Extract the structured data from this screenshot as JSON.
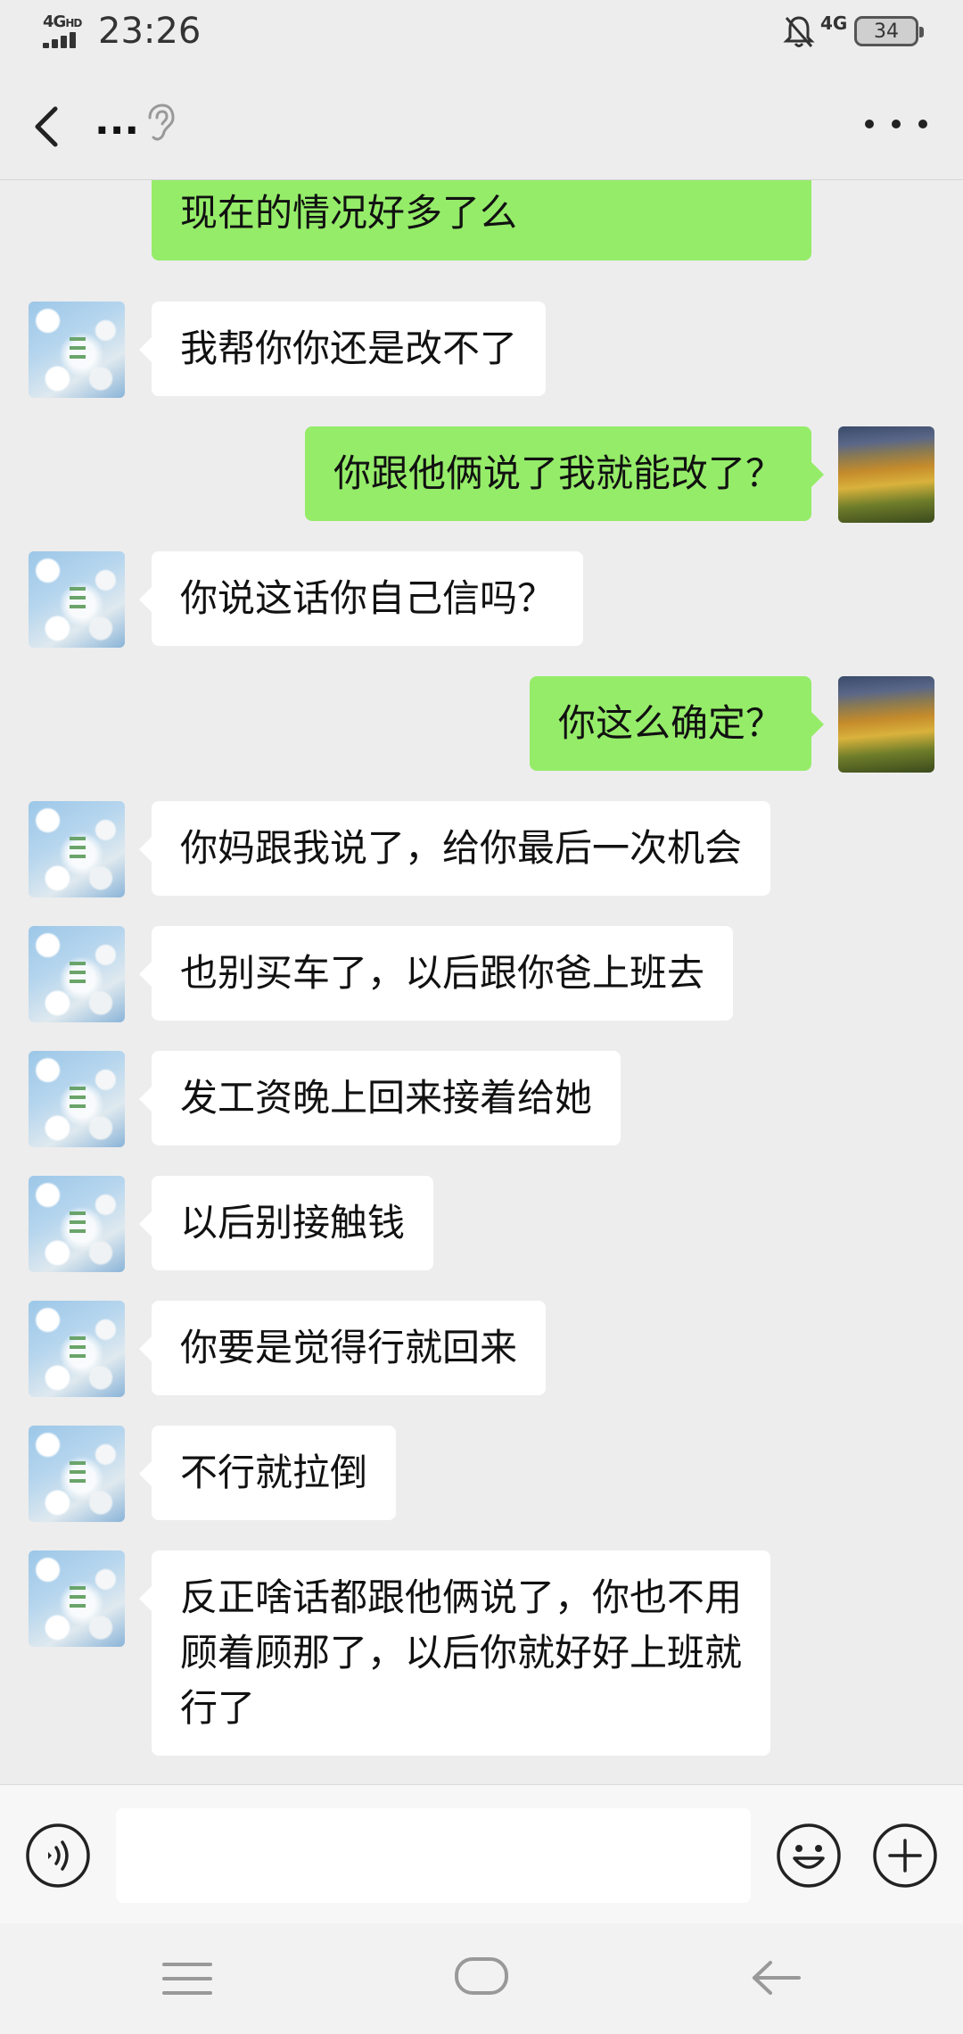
{
  "status_bar": {
    "network_left": "4G",
    "network_left_suffix": "HD",
    "time": "23:26",
    "network_right": "4G",
    "battery": "34"
  },
  "header": {
    "back_icon": "chevron-left-icon",
    "title": "...",
    "earpiece_icon": "ear-icon",
    "more_icon": "more-dots-icon"
  },
  "messages": [
    {
      "side": "out",
      "text": "现在的情况好多了么",
      "partial": true
    },
    {
      "side": "in",
      "text": "我帮你你还是改不了"
    },
    {
      "side": "out",
      "text": "你跟他俩说了我就能改了？"
    },
    {
      "side": "in",
      "text": "你说这话你自己信吗？"
    },
    {
      "side": "out",
      "text": "你这么确定？"
    },
    {
      "side": "in",
      "text": "你妈跟我说了，给你最后一次机会"
    },
    {
      "side": "in",
      "text": "也别买车了，以后跟你爸上班去"
    },
    {
      "side": "in",
      "text": "发工资晚上回来接着给她"
    },
    {
      "side": "in",
      "text": "以后别接触钱"
    },
    {
      "side": "in",
      "text": "你要是觉得行就回来"
    },
    {
      "side": "in",
      "text": "不行就拉倒"
    },
    {
      "side": "in",
      "text": "反正啥话都跟他俩说了，你也不用\n顾着顾那了，以后你就好好上班就\n行了"
    }
  ],
  "input_bar": {
    "voice_icon": "voice-icon",
    "input_value": "",
    "emoji_icon": "emoji-icon",
    "plus_icon": "plus-icon"
  },
  "nav_bar": {
    "menu_icon": "menu-icon",
    "home_icon": "home-icon",
    "back_icon": "back-arrow-icon"
  },
  "colors": {
    "background": "#ededed",
    "incoming_bubble": "#ffffff",
    "outgoing_bubble": "#95ec69"
  }
}
